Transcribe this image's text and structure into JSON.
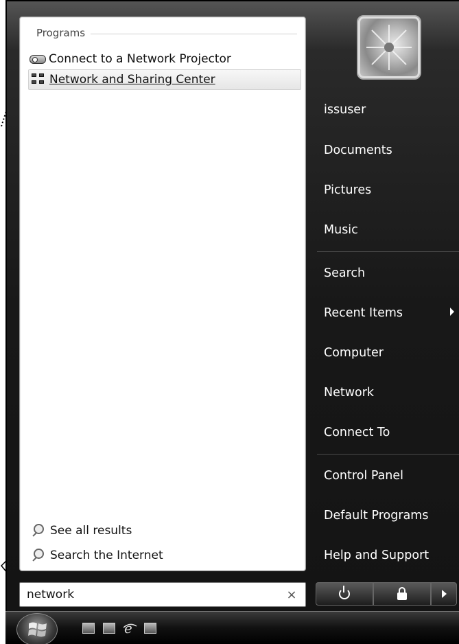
{
  "start_menu": {
    "results": {
      "group_header": "Programs",
      "items": [
        {
          "label": "Connect to a Network Projector",
          "icon": "network-projector-icon"
        },
        {
          "label": "Network and Sharing Center",
          "icon": "network-sharing-center-icon",
          "highlighted": true
        }
      ],
      "see_all": "See all results",
      "search_internet": "Search the Internet"
    },
    "search": {
      "value": "network",
      "clear_label": "×"
    },
    "right_column": {
      "user": "issuser",
      "items": [
        "Documents",
        "Pictures",
        "Music",
        "Search",
        "Recent Items",
        "Computer",
        "Network",
        "Connect To",
        "Control Panel",
        "Default Programs",
        "Help and Support"
      ]
    },
    "power": {
      "buttons": [
        "power-icon",
        "lock-icon",
        "more-options-arrow-icon"
      ]
    }
  },
  "taskbar": {
    "quick_launch": [
      "show-desktop-icon",
      "switch-windows-icon",
      "internet-explorer-icon",
      "media-player-icon"
    ]
  }
}
